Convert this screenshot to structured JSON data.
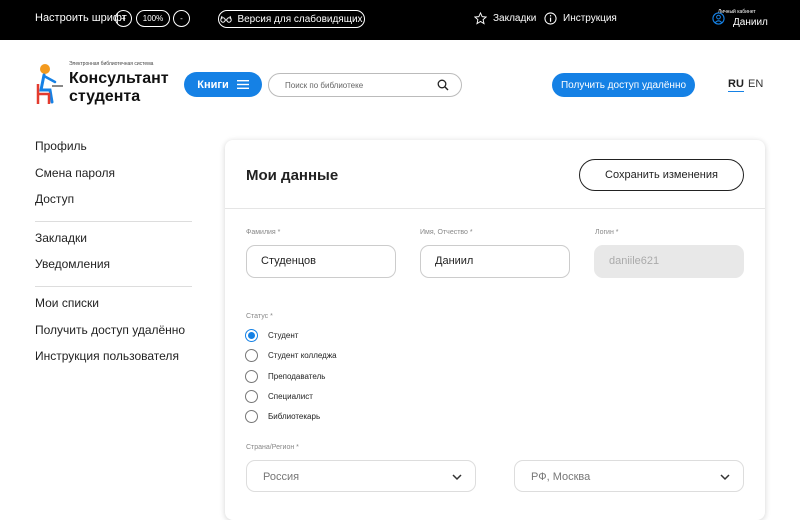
{
  "topbar": {
    "font_label": "Настроить шрифт",
    "font_minus": "+",
    "font_size": "100%",
    "font_plus": "-",
    "vision_label": "Версия для слабовидящих",
    "bookmarks_label": "Закладки",
    "instruction_label": "Инструкция",
    "cabinet_label": "Личный кабинет",
    "user_name": "Даниил"
  },
  "header": {
    "logo_sub": "Электронная библиотечная система",
    "logo_title_1": "Консультант",
    "logo_title_2": "студента",
    "books_label": "Книги",
    "search_placeholder": "Поиск по библиотеке",
    "access_label": "Получить доступ удалённо",
    "lang_ru": "RU",
    "lang_en": "EN"
  },
  "sidebar": {
    "items": [
      "Профиль",
      "Смена пароля",
      "Доступ",
      "Закладки",
      "Уведомления",
      "Мои списки",
      "Получить доступ удалённо",
      "Инструкция пользователя"
    ]
  },
  "form": {
    "title": "Мои данные",
    "save_label": "Сохранить изменения",
    "surname_label": "Фамилия *",
    "surname_value": "Студенцов",
    "name_label": "Имя, Отчество *",
    "name_value": "Даниил",
    "login_label": "Логин *",
    "login_value": "daniile621",
    "status_label": "Статус *",
    "statuses": [
      "Студент",
      "Студент колледжа",
      "Преподаватель",
      "Специалист",
      "Библиотекарь"
    ],
    "selected_status": "Студент",
    "country_label": "Страна/Регион *",
    "country_value": "Россия",
    "region_value": "РФ, Москва"
  },
  "colors": {
    "accent": "#1581e5",
    "topbar": "#000000"
  }
}
